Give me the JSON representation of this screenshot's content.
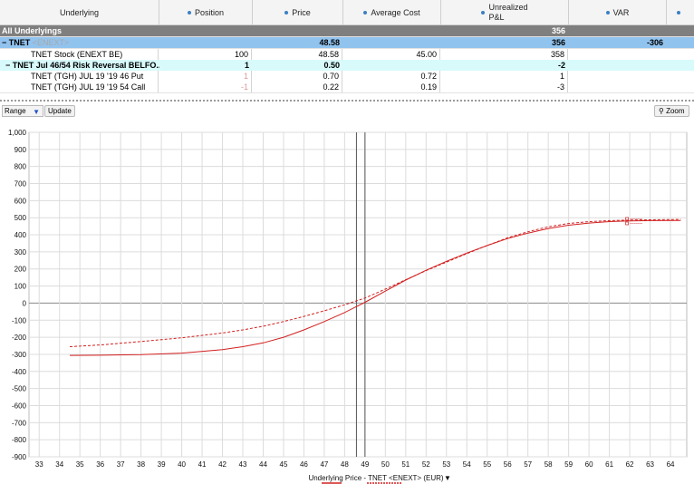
{
  "table": {
    "headers": {
      "underlying": "Underlying",
      "position": "Position",
      "price": "Price",
      "avg_cost": "Average Cost",
      "unrealized_1": "Unrealized",
      "unrealized_2": "P&L",
      "var": "VAR"
    },
    "rows": [
      {
        "label": "All Underlyings",
        "position": "",
        "price": "",
        "avg_cost": "",
        "pnl": "356",
        "var": ""
      },
      {
        "label": "TNET",
        "label_suffix": "<ENEXT>",
        "position": "",
        "price": "48.58",
        "avg_cost": "",
        "pnl": "356",
        "var": "-306"
      },
      {
        "label": "TNET Stock (ENEXT BE)",
        "position": "100",
        "price": "48.58",
        "avg_cost": "45.00",
        "pnl": "358",
        "var": ""
      },
      {
        "label": "TNET Jul 46/54 Risk Reversal BELFO...",
        "position": "1",
        "price": "0.50",
        "avg_cost": "",
        "pnl": "-2",
        "var": ""
      },
      {
        "label": "TNET (TGH) JUL 19 '19 46 Put",
        "position": "1",
        "price": "0.70",
        "avg_cost": "0.72",
        "pnl": "1",
        "var": ""
      },
      {
        "label": "TNET (TGH) JUL 19 '19 54 Call",
        "position": "-1",
        "price": "0.22",
        "avg_cost": "0.19",
        "pnl": "-3",
        "var": ""
      }
    ]
  },
  "toolbar": {
    "range_label": "Range",
    "update_label": "Update",
    "zoom_label": "Zoom"
  },
  "chart_data": {
    "type": "line",
    "xlabel": "Underlying Price - TNET <ENEXT> (EUR)",
    "ylabel": "",
    "xlim": [
      32.5,
      64.8
    ],
    "ylim": [
      -900,
      1000
    ],
    "xticks": [
      33,
      34,
      35,
      36,
      37,
      38,
      39,
      40,
      41,
      42,
      43,
      44,
      45,
      46,
      47,
      48,
      49,
      50,
      51,
      52,
      53,
      54,
      55,
      56,
      57,
      58,
      59,
      60,
      61,
      62,
      63,
      64
    ],
    "yticks": [
      -900,
      -800,
      -700,
      -600,
      -500,
      -400,
      -300,
      -200,
      -100,
      0,
      100,
      200,
      300,
      400,
      500,
      600,
      700,
      800,
      900,
      1000
    ],
    "grid": true,
    "vertical_markers": [
      48.58,
      49.0
    ],
    "series_solid": {
      "style": "solid",
      "x": [
        34.5,
        36,
        38,
        40,
        42,
        43,
        44,
        45,
        46,
        47,
        48,
        49,
        50,
        51,
        52,
        53,
        54,
        55,
        56,
        57,
        58,
        59,
        60,
        61,
        62,
        63,
        64.5
      ],
      "values": [
        -306,
        -305,
        -302,
        -293,
        -272,
        -255,
        -233,
        -200,
        -157,
        -108,
        -55,
        5,
        70,
        135,
        192,
        245,
        293,
        337,
        378,
        410,
        437,
        456,
        469,
        477,
        481,
        483,
        484
      ]
    },
    "series_dashed": {
      "style": "dashed",
      "x": [
        34.5,
        36,
        38,
        40,
        42,
        43,
        44,
        45,
        46,
        47,
        48,
        49,
        50,
        51,
        52,
        53,
        54,
        55,
        56,
        57,
        58,
        59,
        60,
        61,
        62,
        63,
        64.5
      ],
      "values": [
        -255,
        -245,
        -225,
        -203,
        -175,
        -157,
        -135,
        -108,
        -78,
        -45,
        -10,
        30,
        82,
        137,
        190,
        240,
        290,
        337,
        382,
        418,
        447,
        466,
        477,
        483,
        486,
        488,
        490
      ]
    },
    "legend_marks": [
      "sample-a",
      "sample-b"
    ],
    "colors": {
      "line": "#d31f1f",
      "grid": "#dcdcdc",
      "marker": "#555555"
    }
  }
}
